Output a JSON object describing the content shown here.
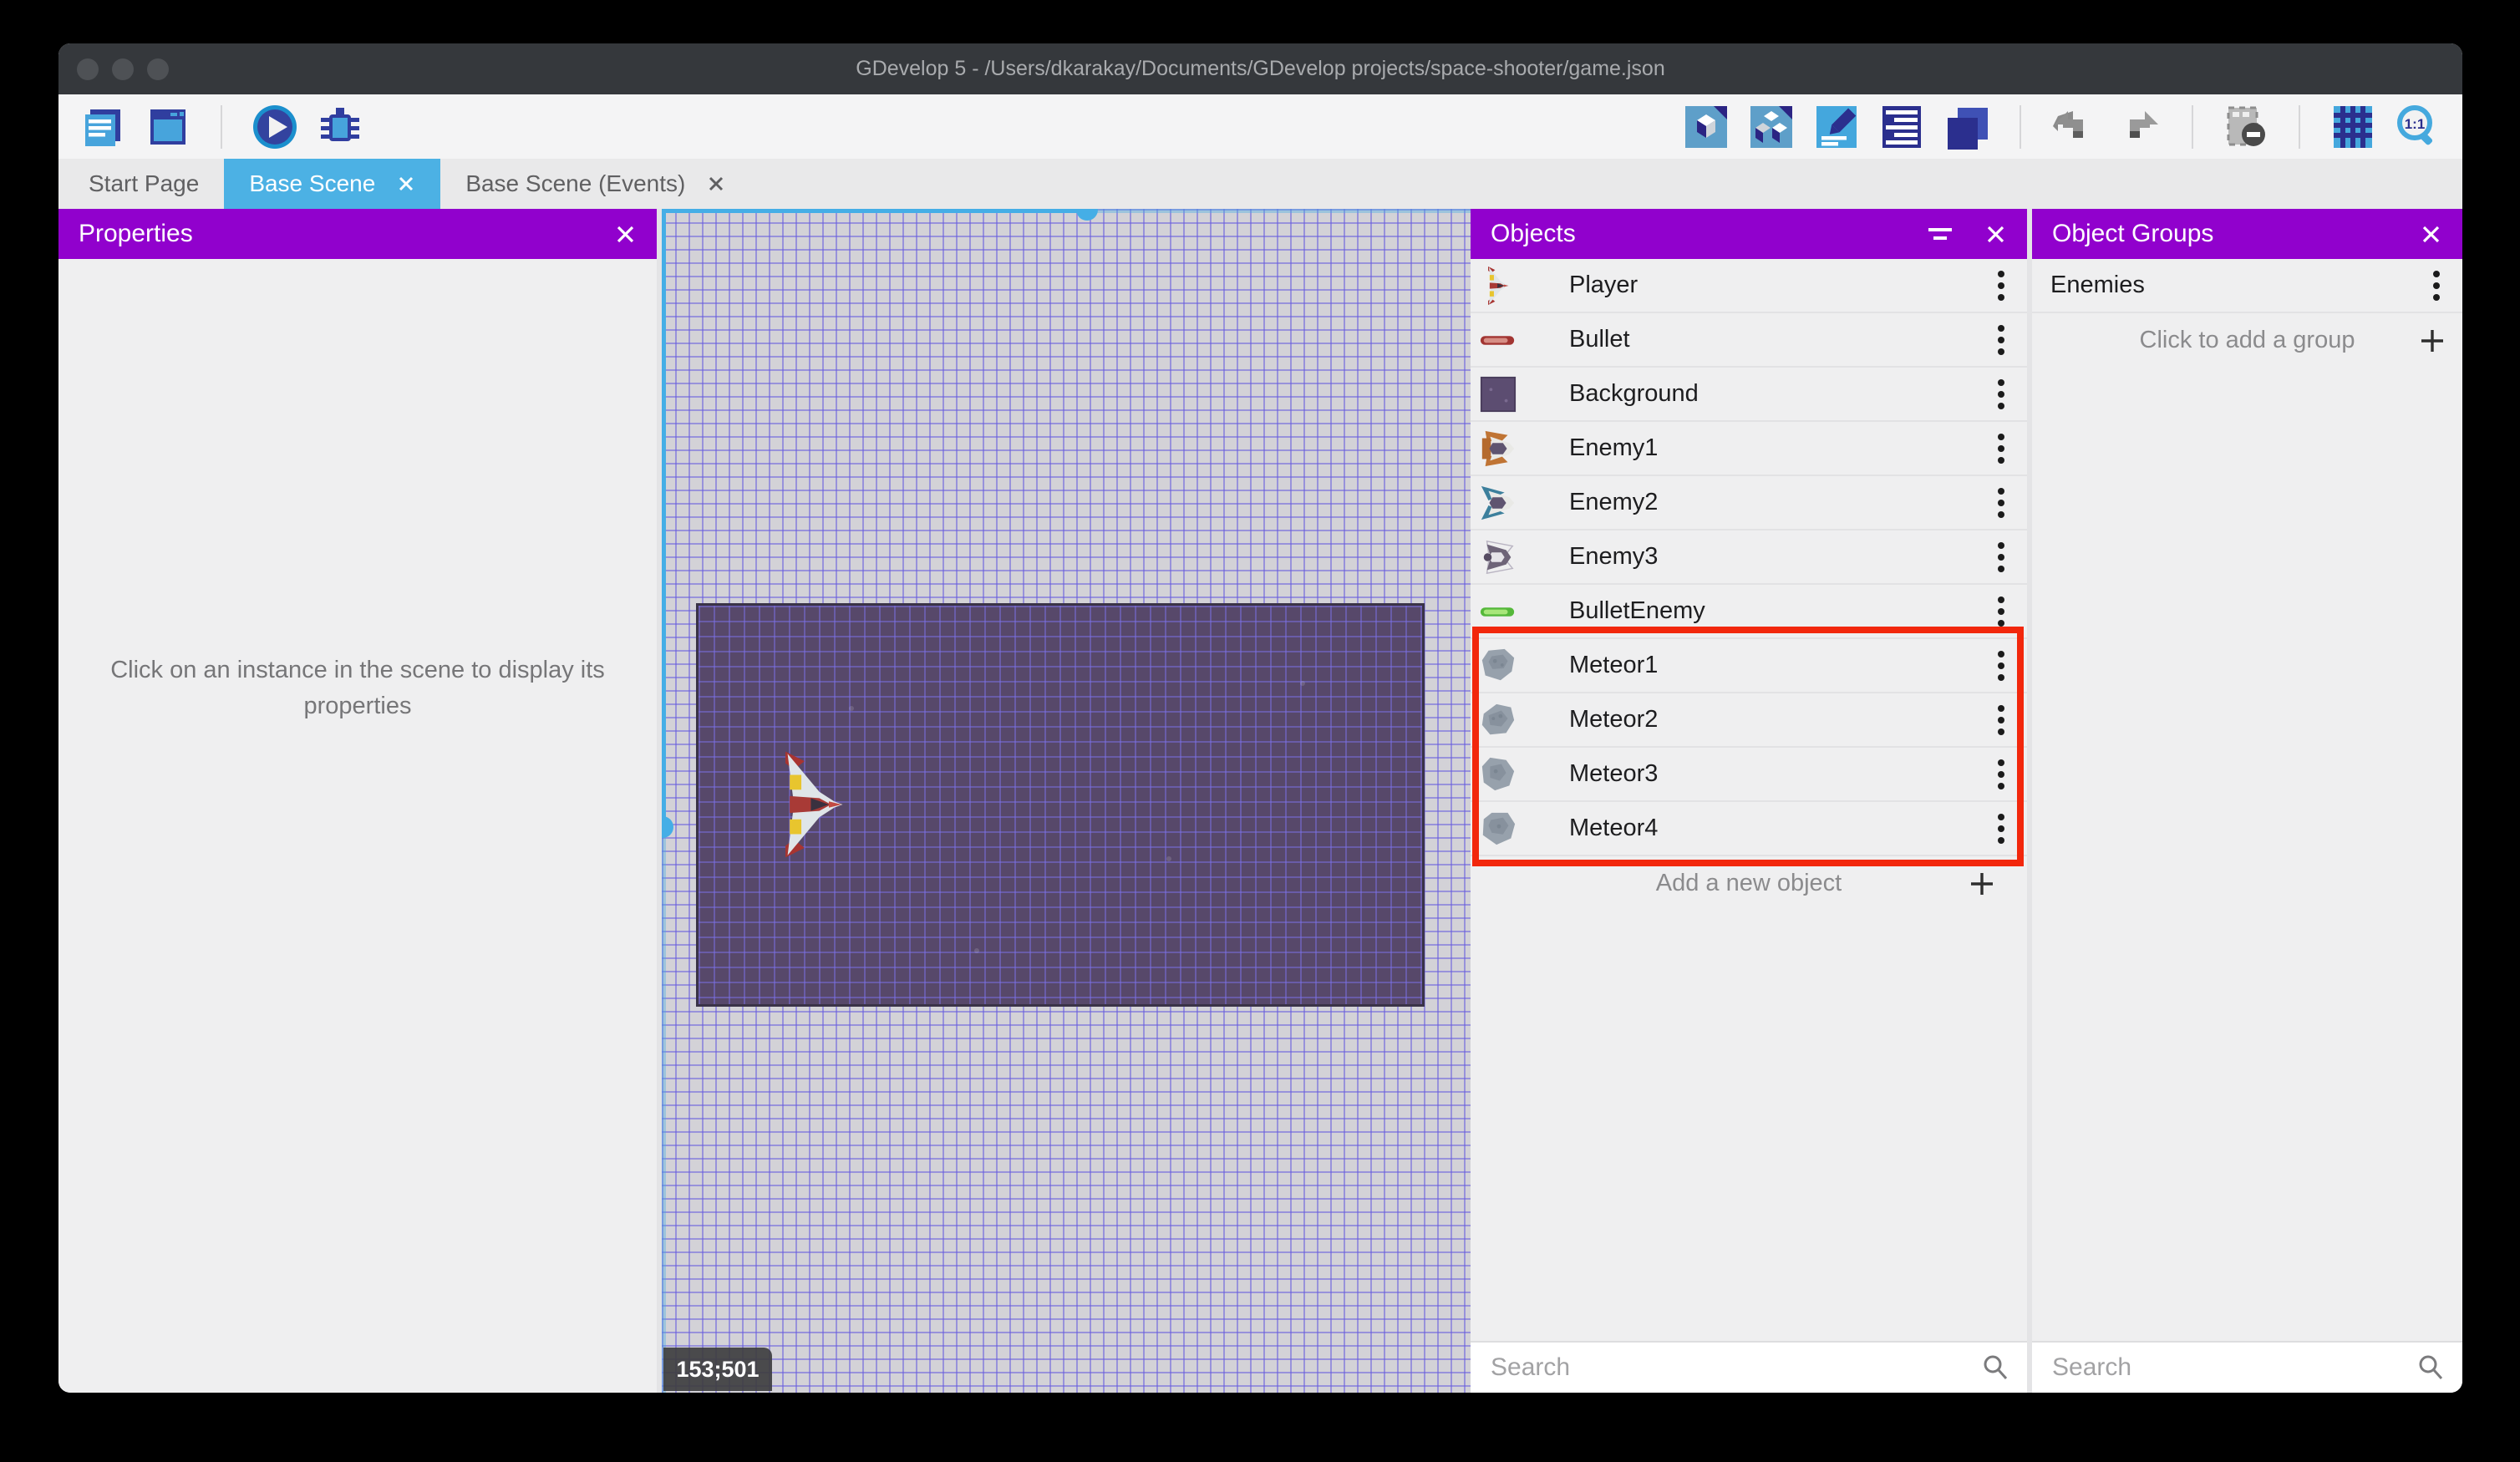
{
  "window": {
    "title": "GDevelop 5 - /Users/dkarakay/Documents/GDevelop projects/space-shooter/game.json"
  },
  "toolbar": {
    "left_icons": [
      "project-manager-icon",
      "scene-window-icon",
      "play-icon",
      "debug-icon"
    ],
    "right_icons": [
      "objects-cube-icon",
      "instances-cubes-icon",
      "properties-pencil-icon",
      "layers-list-icon",
      "layers-stack-icon",
      "undo-icon",
      "redo-icon",
      "mask-remove-icon",
      "grid-icon",
      "zoom-one-to-one-icon"
    ],
    "zoom_ratio_label": "1:1"
  },
  "tabs": [
    {
      "label": "Start Page",
      "active": false,
      "closable": false
    },
    {
      "label": "Base Scene",
      "active": true,
      "closable": true
    },
    {
      "label": "Base Scene (Events)",
      "active": false,
      "closable": true
    }
  ],
  "properties_panel": {
    "title": "Properties",
    "empty_message": "Click on an instance in the scene to display its properties"
  },
  "scene": {
    "cursor_coordinates": "153;501",
    "selection_color": "#45aee6",
    "grid_line_color": "#685cde",
    "background_object_color": "#57486a"
  },
  "objects_panel": {
    "title": "Objects",
    "items": [
      {
        "name": "Player",
        "icon": "player-ship"
      },
      {
        "name": "Bullet",
        "icon": "bullet-red"
      },
      {
        "name": "Background",
        "icon": "background-tile"
      },
      {
        "name": "Enemy1",
        "icon": "enemy1-ship"
      },
      {
        "name": "Enemy2",
        "icon": "enemy2-ship"
      },
      {
        "name": "Enemy3",
        "icon": "enemy3-ship"
      },
      {
        "name": "BulletEnemy",
        "icon": "bullet-green"
      },
      {
        "name": "Meteor1",
        "icon": "meteor-1"
      },
      {
        "name": "Meteor2",
        "icon": "meteor-2"
      },
      {
        "name": "Meteor3",
        "icon": "meteor-3"
      },
      {
        "name": "Meteor4",
        "icon": "meteor-4"
      }
    ],
    "highlighted_items": [
      "Meteor1",
      "Meteor2",
      "Meteor3",
      "Meteor4"
    ],
    "highlight_color": "#f2270c",
    "add_label": "Add a new object",
    "search_placeholder": "Search"
  },
  "groups_panel": {
    "title": "Object Groups",
    "items": [
      {
        "name": "Enemies"
      }
    ],
    "add_label": "Click to add a group",
    "search_placeholder": "Search"
  },
  "colors": {
    "panel_header": "#9101cd",
    "active_tab": "#4cb1e4",
    "titlebar": "#35383c"
  }
}
